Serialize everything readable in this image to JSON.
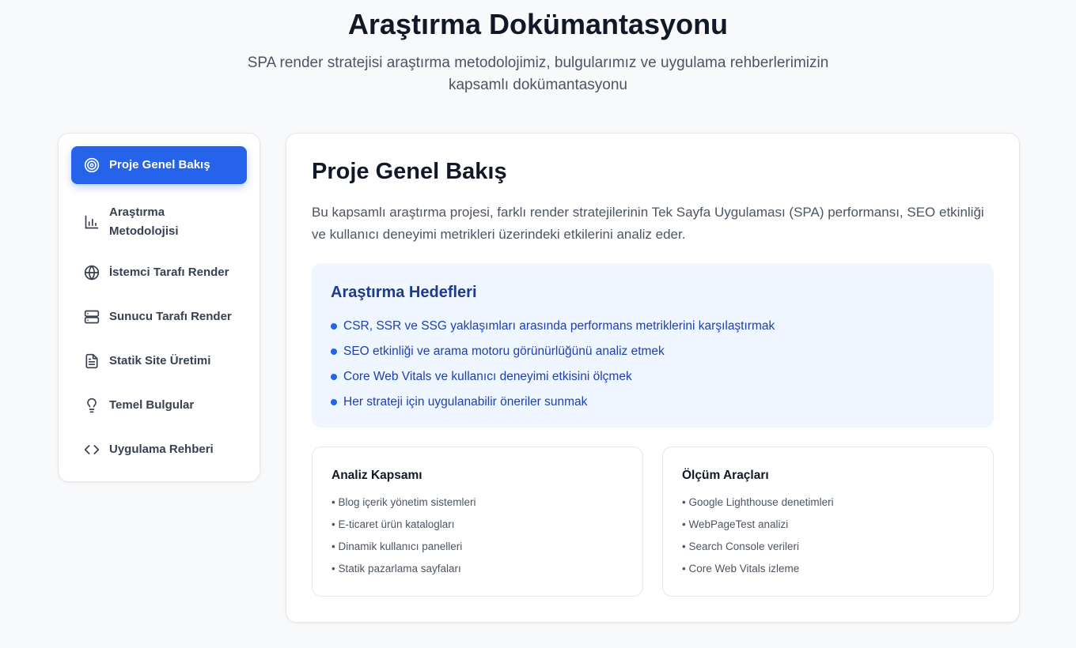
{
  "header": {
    "title": "Araştırma Dokümantasyonu",
    "subtitle": "SPA render stratejisi araştırma metodolojimiz, bulgularımız ve uygulama rehberlerimizin kapsamlı dokümantasyonu"
  },
  "sidebar": {
    "items": [
      {
        "label": "Proje Genel Bakış",
        "icon": "target-icon",
        "active": true
      },
      {
        "label": "Araştırma Metodolojisi",
        "icon": "bar-chart-icon",
        "active": false
      },
      {
        "label": "İstemci Tarafı Render",
        "icon": "globe-icon",
        "active": false
      },
      {
        "label": "Sunucu Tarafı Render",
        "icon": "server-icon",
        "active": false
      },
      {
        "label": "Statik Site Üretimi",
        "icon": "file-text-icon",
        "active": false
      },
      {
        "label": "Temel Bulgular",
        "icon": "lightbulb-icon",
        "active": false
      },
      {
        "label": "Uygulama Rehberi",
        "icon": "code-icon",
        "active": false
      }
    ]
  },
  "main": {
    "title": "Proje Genel Bakış",
    "intro": "Bu kapsamlı araştırma projesi, farklı render stratejilerinin Tek Sayfa Uygulaması (SPA) performansı, SEO etkinliği ve kullanıcı deneyimi metrikleri üzerindeki etkilerini analiz eder.",
    "goals": {
      "title": "Araştırma Hedefleri",
      "items": [
        "CSR, SSR ve SSG yaklaşımları arasında performans metriklerini karşılaştırmak",
        "SEO etkinliği ve arama motoru görünürlüğünü analiz etmek",
        "Core Web Vitals ve kullanıcı deneyimi etkisini ölçmek",
        "Her strateji için uygulanabilir öneriler sunmak"
      ]
    },
    "scope": {
      "title": "Analiz Kapsamı",
      "items": [
        "• Blog içerik yönetim sistemleri",
        "• E-ticaret ürün katalogları",
        "• Dinamik kullanıcı panelleri",
        "• Statik pazarlama sayfaları"
      ]
    },
    "tools": {
      "title": "Ölçüm Araçları",
      "items": [
        "• Google Lighthouse denetimleri",
        "• WebPageTest analizi",
        "• Search Console verileri",
        "• Core Web Vitals izleme"
      ]
    }
  },
  "colors": {
    "accent": "#2563eb",
    "goals_bg": "#eff6ff",
    "goals_text": "#1e40af"
  }
}
